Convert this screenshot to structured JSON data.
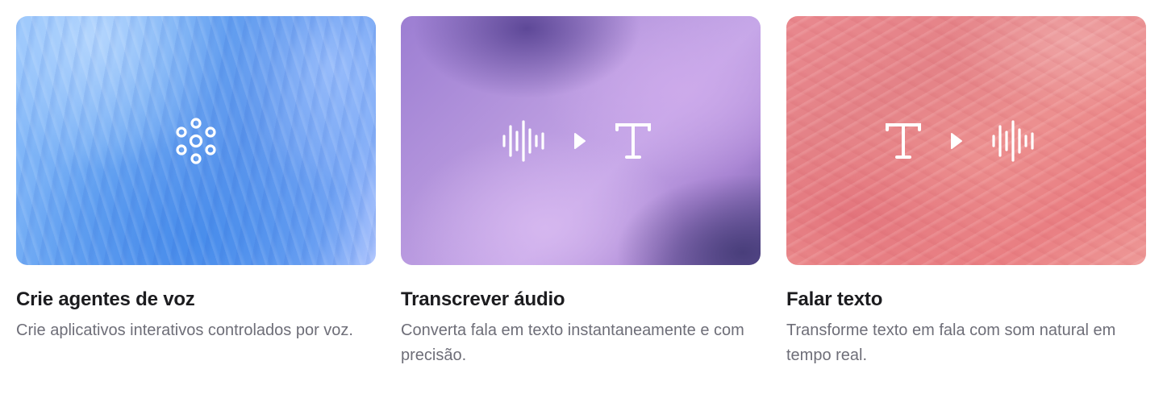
{
  "cards": [
    {
      "title": "Crie agentes de voz",
      "description": "Crie aplicativos interativos controlados por voz.",
      "icons": [
        "voice-agent-dots-icon"
      ],
      "colors": {
        "background": "#6aa6f2"
      }
    },
    {
      "title": "Transcrever áudio",
      "description": "Converta fala em texto instantaneamente e com precisão.",
      "icons": [
        "waveform-icon",
        "play-arrow-icon",
        "text-t-icon"
      ],
      "colors": {
        "background": "#b596dd"
      }
    },
    {
      "title": "Falar texto",
      "description": "Transforme texto em fala com som natural em tempo real.",
      "icons": [
        "text-t-icon",
        "play-arrow-icon",
        "waveform-icon"
      ],
      "colors": {
        "background": "#e48287"
      }
    }
  ],
  "colors": {
    "title": "#1c1c1f",
    "description": "#6e6e78",
    "icon": "#ffffff"
  }
}
